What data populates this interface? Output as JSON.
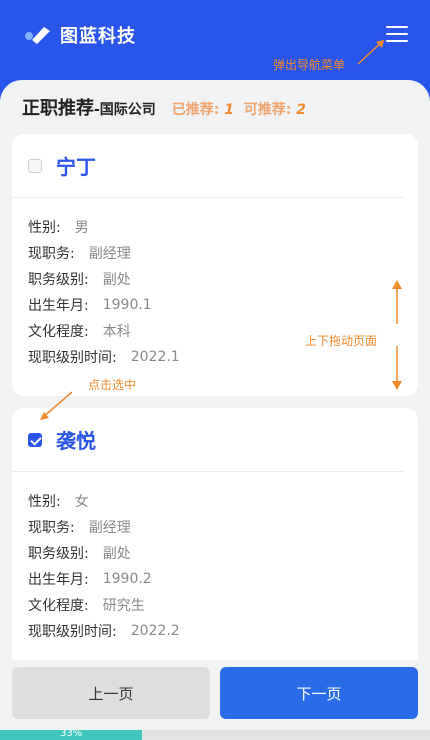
{
  "app": {
    "title": "图蓝科技",
    "logo_icon": "logo-check-icon",
    "menu_icon": "hamburger-menu-icon"
  },
  "colors": {
    "brand": "#2a55ea",
    "accent": "#f08a2c",
    "progress": "#3fc7bf"
  },
  "annotations": {
    "menu": "弹出导航菜单",
    "drag": "上下拖动页面",
    "select": "点击选中"
  },
  "page": {
    "title": "正职推荐",
    "subtitle": "-国际公司",
    "recommended_label": "已推荐:",
    "recommended_count": "1",
    "available_label": "可推荐:",
    "available_count": "2"
  },
  "candidates": [
    {
      "name": "宁丁",
      "checked": false,
      "fields": [
        {
          "label": "性别:",
          "value": "男"
        },
        {
          "label": "现职务:",
          "value": "副经理"
        },
        {
          "label": "职务级别:",
          "value": "副处"
        },
        {
          "label": "出生年月:",
          "value": "1990.1"
        },
        {
          "label": "文化程度:",
          "value": "本科"
        },
        {
          "label": "现职级别时间:",
          "value": "2022.1"
        }
      ]
    },
    {
      "name": "袭悦",
      "checked": true,
      "fields": [
        {
          "label": "性别:",
          "value": "女"
        },
        {
          "label": "现职务:",
          "value": "副经理"
        },
        {
          "label": "职务级别:",
          "value": "副处"
        },
        {
          "label": "出生年月:",
          "value": "1990.2"
        },
        {
          "label": "文化程度:",
          "value": "研究生"
        },
        {
          "label": "现职级别时间:",
          "value": "2022.2"
        }
      ]
    }
  ],
  "buttons": {
    "prev": "上一页",
    "next": "下一页"
  },
  "progress": {
    "label": "33%",
    "fraction": 0.33
  }
}
